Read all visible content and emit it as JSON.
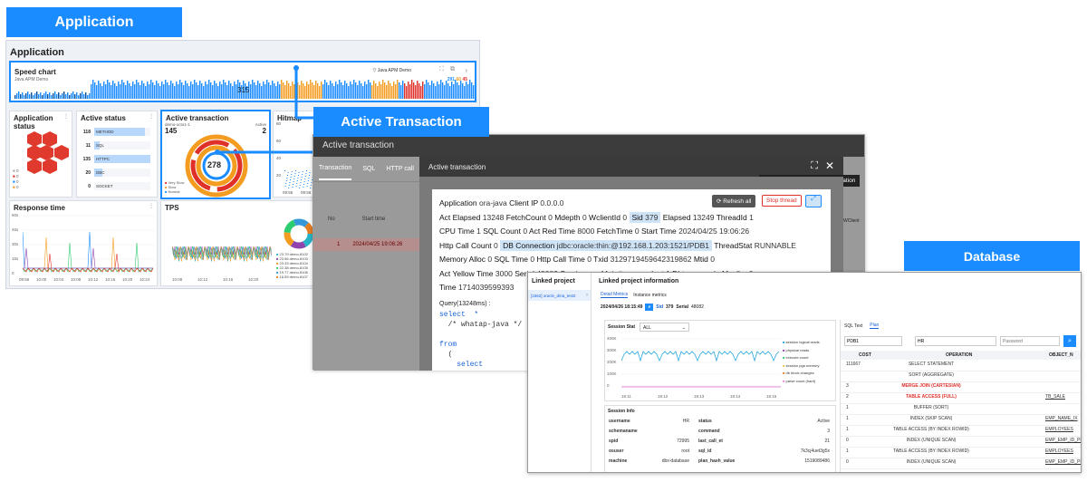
{
  "labels": {
    "application": "Application",
    "active_transaction": "Active Transaction",
    "database": "Database"
  },
  "dashboard": {
    "title": "Application",
    "speed_chart": {
      "title": "Speed chart",
      "subtitle": "Java APM Demo",
      "count": "315",
      "filter_label": "Java APM Demo",
      "counts": [
        "291",
        "60",
        "45"
      ]
    },
    "app_status": {
      "title": "Application status",
      "legend": [
        "0",
        "0",
        "0",
        "0"
      ]
    },
    "active_status": {
      "title": "Active status",
      "rows": [
        {
          "value": "118",
          "label": "METHOD",
          "fill": 0.9
        },
        {
          "value": "11",
          "label": "SQL",
          "fill": 0.1
        },
        {
          "value": "135",
          "label": "HTTPC",
          "fill": 1.0
        },
        {
          "value": "20",
          "label": "DBC",
          "fill": 0.15
        },
        {
          "value": "0",
          "label": "SOCKET",
          "fill": 0
        }
      ]
    },
    "active_tx": {
      "title": "Active transaction",
      "agent": "demo-octo1-1",
      "left_value": "145",
      "active_label": "Active",
      "right_value": "2",
      "center": "278",
      "legend": [
        "Very Slow",
        "Slow",
        "Normal"
      ]
    },
    "hitmap": {
      "title": "Hitmap",
      "y": [
        "80",
        "60",
        "40",
        "20"
      ],
      "x": [
        "09:55",
        "09:56"
      ]
    },
    "response_time": {
      "title": "Response time",
      "y": [
        "60s",
        "45s",
        "30s",
        "15s",
        "0"
      ],
      "x": [
        "09:56",
        "10:00",
        "10:04",
        "10:08",
        "10:12",
        "10:16",
        "10:20",
        "10:24"
      ]
    },
    "tps": {
      "title": "TPS",
      "x": [
        "10:08",
        "10:12",
        "10:16",
        "10:20"
      ],
      "legend": [
        "23.79 demo-8102",
        "23.56 demo-8103",
        "23.33 demo-8104",
        "22.38 demo-8105",
        "19.77 demo-8106",
        "16.59 demo-8107"
      ]
    }
  },
  "at_window": {
    "title": "Active transaction",
    "tabs": [
      "Transaction",
      "SQL",
      "HTTP call"
    ],
    "table_headers": [
      "No",
      "Start time"
    ],
    "table_row": [
      "1",
      "2024/04/25 19:06:26"
    ],
    "right_header": "WClient",
    "dialog": {
      "title": "Active transaction",
      "tooltip": "View linked DB session information",
      "refresh_label": "Refresh all",
      "stop_label": "Stop thread",
      "lines": [
        [
          [
            "Application",
            "ora-java"
          ],
          [
            "Client IP",
            "0.0.0.0"
          ]
        ],
        [
          [
            "Act Elapsed",
            "13248"
          ],
          [
            "FetchCount",
            "0"
          ],
          [
            "Mdepth",
            "0"
          ],
          [
            "WclientId",
            "0"
          ],
          [
            "Sid",
            "379"
          ],
          [
            "Elapsed",
            "13249"
          ],
          [
            "ThreadId",
            "1"
          ]
        ],
        [
          [
            "CPU Time",
            "1"
          ],
          [
            "SQL Count",
            "0"
          ],
          [
            "Act Red Time",
            "8000"
          ],
          [
            "FetchTime",
            "0"
          ],
          [
            "Start Time",
            "2024/04/25 19:06:26"
          ]
        ],
        [
          [
            "Http Call Count",
            "0"
          ],
          [
            "DB Connection",
            "jdbc:oracle:thin:@192.168.1.203:1521/PDB1"
          ],
          [
            "ThreadStat",
            "RUNNABLE"
          ]
        ],
        [
          [
            "Memory Alloc",
            "0"
          ],
          [
            "SQL Time",
            "0"
          ],
          [
            "Http Call Time",
            "0"
          ],
          [
            "Txid",
            "3129719459642319862"
          ],
          [
            "Mtid",
            "0"
          ]
        ],
        [
          [
            "Act Yellow Time",
            "3000"
          ],
          [
            "Serial",
            "48082"
          ],
          [
            "Service",
            "ora.Main#process"
          ],
          [
            "Inst",
            "1"
          ],
          [
            "Dbtype",
            "oracle"
          ],
          [
            "Mcaller",
            "0"
          ]
        ],
        [
          [
            "Time",
            "1714039599393"
          ]
        ]
      ],
      "query_title": "Query(13248ms) :",
      "query_lines": [
        "select  *",
        "  /* whatap-java */",
        "",
        "from",
        "  (",
        "    select"
      ]
    }
  },
  "db_window": {
    "linked_project_label": "Linked project",
    "linked_info_label": "Linked project information",
    "project_item": "[1562] oracle_dma_test2",
    "tabs": [
      "Detail Metrics",
      "Instance metrics"
    ],
    "timestamp": "2024/04/26 18:15:49",
    "sid_label": "Sid",
    "sid_value": "379",
    "serial_label": "Serial",
    "serial_value": "48082",
    "session_stat": {
      "title": "Session Stat",
      "select": "ALL",
      "y": [
        "400K",
        "300K",
        "200K",
        "100K",
        "0"
      ],
      "x": [
        "18:11",
        "18:12",
        "18:13",
        "18:14",
        "18:15"
      ],
      "legend": [
        "session logical reads",
        "physical reads",
        "execute count",
        "session pga memory",
        "db block changes",
        "parse count (hard)"
      ]
    },
    "session_info": {
      "title": "Session Info",
      "rows": [
        [
          "username",
          "HR",
          "status",
          "Active"
        ],
        [
          "schemaname",
          "",
          "command",
          "3"
        ],
        [
          "spid",
          "72995",
          "last_call_et",
          "21"
        ],
        [
          "osuser",
          "root",
          "sql_id",
          "7k3cj4uet3g5x"
        ],
        [
          "machine",
          "dbx-database",
          "plan_hash_value",
          "1519089486"
        ]
      ]
    },
    "plan": {
      "tabs": [
        "SQL Text",
        "Plan"
      ],
      "inputs": [
        "PDB1",
        "HR",
        "Password"
      ],
      "headers": [
        "COST",
        "OPERATION",
        "OBJECT_N"
      ],
      "rows": [
        [
          "111667",
          "SELECT STATEMENT",
          ""
        ],
        [
          "",
          "SORT (AGGREGATE)",
          ""
        ],
        [
          "3",
          "MERGE JOIN (CARTESIAN)",
          ""
        ],
        [
          "2",
          "TABLE ACCESS (FULL)",
          "TB_SALE"
        ],
        [
          "1",
          "BUFFER (SORT)",
          ""
        ],
        [
          "1",
          "INDEX (SKIP SCAN)",
          "EMP_NAME_IX"
        ],
        [
          "1",
          "TABLE ACCESS (BY INDEX ROWID)",
          "EMPLOYEES"
        ],
        [
          "0",
          "INDEX (UNIQUE SCAN)",
          "EMP_EMP_ID_PK"
        ],
        [
          "1",
          "TABLE ACCESS (BY INDEX ROWID)",
          "EMPLOYEES"
        ],
        [
          "0",
          "INDEX (UNIQUE SCAN)",
          "EMP_EMP_ID_PK"
        ]
      ]
    }
  },
  "colors": {
    "accent": "#1a8cff",
    "orange": "#f39c1f",
    "red": "#e0302a",
    "hex": "#e03a2e"
  }
}
